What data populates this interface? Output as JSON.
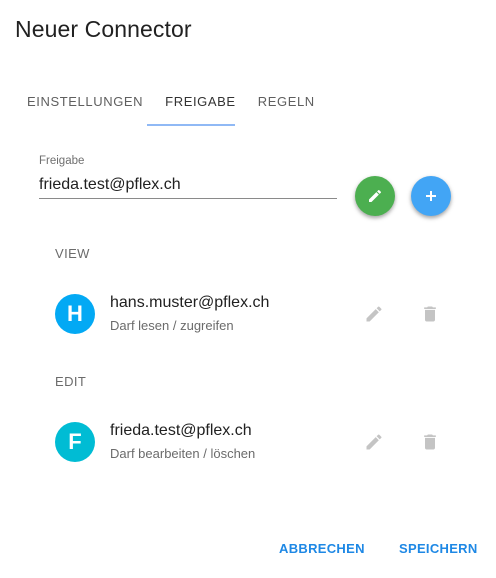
{
  "dialog": {
    "title": "Neuer Connector"
  },
  "tabs": [
    {
      "label": "EINSTELLUNGEN",
      "active": false
    },
    {
      "label": "FREIGABE",
      "active": true
    },
    {
      "label": "REGELN",
      "active": false
    }
  ],
  "share_field": {
    "label": "Freigabe",
    "value": "frieda.test@pflex.ch",
    "edit_icon": "pencil-icon",
    "add_icon": "plus-icon"
  },
  "sections": [
    {
      "label": "VIEW",
      "entries": [
        {
          "initial": "H",
          "email": "hans.muster@pflex.ch",
          "permission": "Darf lesen / zugreifen",
          "avatar_color": "#03a9f4"
        }
      ]
    },
    {
      "label": "EDIT",
      "entries": [
        {
          "initial": "F",
          "email": "frieda.test@pflex.ch",
          "permission": "Darf bearbeiten / löschen",
          "avatar_color": "#00bcd4"
        }
      ]
    }
  ],
  "actions": {
    "cancel_label": "ABBRECHEN",
    "save_label": "SPEICHERN"
  },
  "colors": {
    "primary": "#1e88e5",
    "fab_edit": "#4caf50",
    "fab_add": "#42a5f5",
    "tab_indicator": "#90b9f5",
    "row_icon": "#c4c4c4"
  }
}
